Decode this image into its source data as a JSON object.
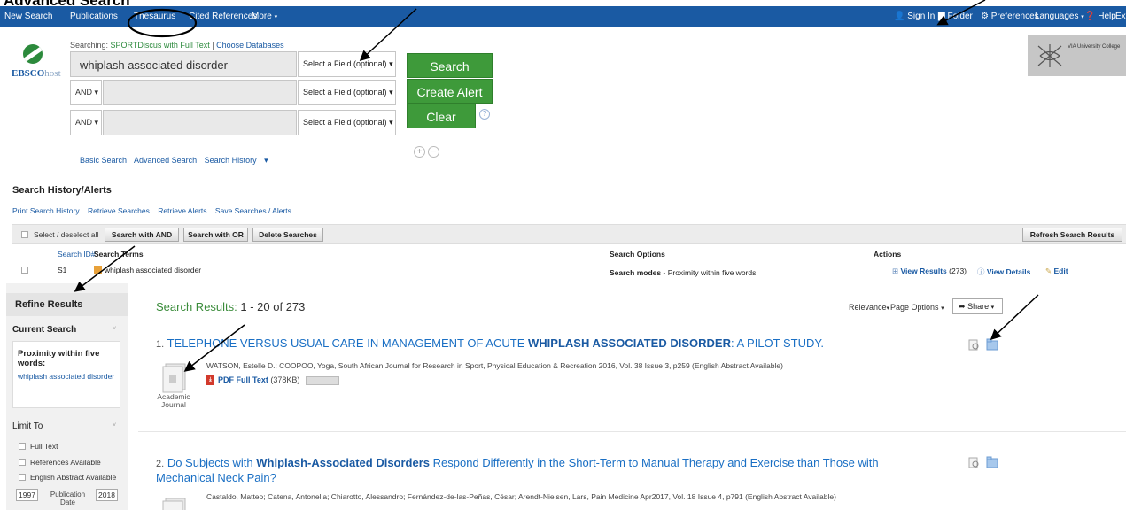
{
  "page_heading": "Advanced Search",
  "topbar": {
    "left": [
      "New Search",
      "Publications",
      "Thesaurus",
      "Cited References",
      "More"
    ],
    "right": [
      "Sign In",
      "Folder",
      "Preferences",
      "Languages",
      "Help",
      "Exit"
    ]
  },
  "brand": {
    "logo_bold": "EBSCO",
    "logo_light": "host"
  },
  "searching": {
    "label": "Searching:",
    "db": "SPORTDiscus with Full Text",
    "sep": "|",
    "choose": "Choose Databases"
  },
  "search_rows": [
    {
      "operator": "",
      "value": "whiplash associated disorder",
      "field": "Select a Field (optional)"
    },
    {
      "operator": "AND",
      "value": "",
      "field": "Select a Field (optional)"
    },
    {
      "operator": "AND",
      "value": "",
      "field": "Select a Field (optional)"
    }
  ],
  "buttons": {
    "search": "Search",
    "create_alert": "Create Alert",
    "clear": "Clear",
    "help": "?",
    "add": "+",
    "remove": "−"
  },
  "search_links": [
    "Basic Search",
    "Advanced Search",
    "Search History"
  ],
  "institution": {
    "name": "VIA University College"
  },
  "history": {
    "title": "Search History/Alerts",
    "links": [
      "Print Search History",
      "Retrieve Searches",
      "Retrieve Alerts",
      "Save Searches / Alerts"
    ],
    "select_all": "Select / deselect all",
    "btn_and": "Search with AND",
    "btn_or": "Search with OR",
    "btn_delete": "Delete Searches",
    "btn_refresh": "Refresh Search Results",
    "headers": {
      "id": "Search ID#",
      "terms": "Search Terms",
      "options": "Search Options",
      "actions": "Actions"
    },
    "row": {
      "id": "S1",
      "terms": "whiplash associated disorder",
      "options_label": "Search modes",
      "options_value": "- Proximity within five words",
      "view_results": "View Results",
      "count": "(273)",
      "view_details": "View Details",
      "edit": "Edit"
    }
  },
  "refine": {
    "title": "Refine Results",
    "current_search": "Current Search",
    "cs_title": "Proximity within five words:",
    "cs_value": "whiplash associated disorder",
    "limit_to": "Limit To",
    "limits": [
      "Full Text",
      "References Available",
      "English Abstract Available"
    ],
    "year_from": "1997",
    "year_to": "2018",
    "pub_date": "Publication Date"
  },
  "results": {
    "label": "Search Results:",
    "range": "1 - 20 of 273",
    "relevance": "Relevance",
    "page_options": "Page Options",
    "share": "Share",
    "items": [
      {
        "num": "1.",
        "title_a": "TELEPHONE VERSUS USUAL CARE IN MANAGEMENT OF ACUTE ",
        "title_b": "WHIPLASH ASSOCIATED DISORDER",
        "title_c": ": A PILOT STUDY.",
        "meta": "WATSON, Estelle D.; COOPOO, Yoga, South African Journal for Research in Sport, Physical Education & Recreation 2016, Vol. 38 Issue 3, p259 (English Abstract Available)",
        "pdf": "PDF Full Text",
        "pdf_size": "(378KB)",
        "type": "Academic Journal"
      },
      {
        "num": "2.",
        "title_a": "Do Subjects with ",
        "title_b": "Whiplash-Associated Disorders",
        "title_c": " Respond Differently in the Short-Term to Manual Therapy and Exercise than Those with Mechanical Neck Pain?",
        "meta": "Castaldo, Matteo; Catena, Antonella; Chiarotto, Alessandro; Fernández-de-las-Peñas, César; Arendt-Nielsen, Lars, Pain Medicine Apr2017, Vol. 18 Issue 4, p791 (English Abstract Available)"
      }
    ]
  }
}
